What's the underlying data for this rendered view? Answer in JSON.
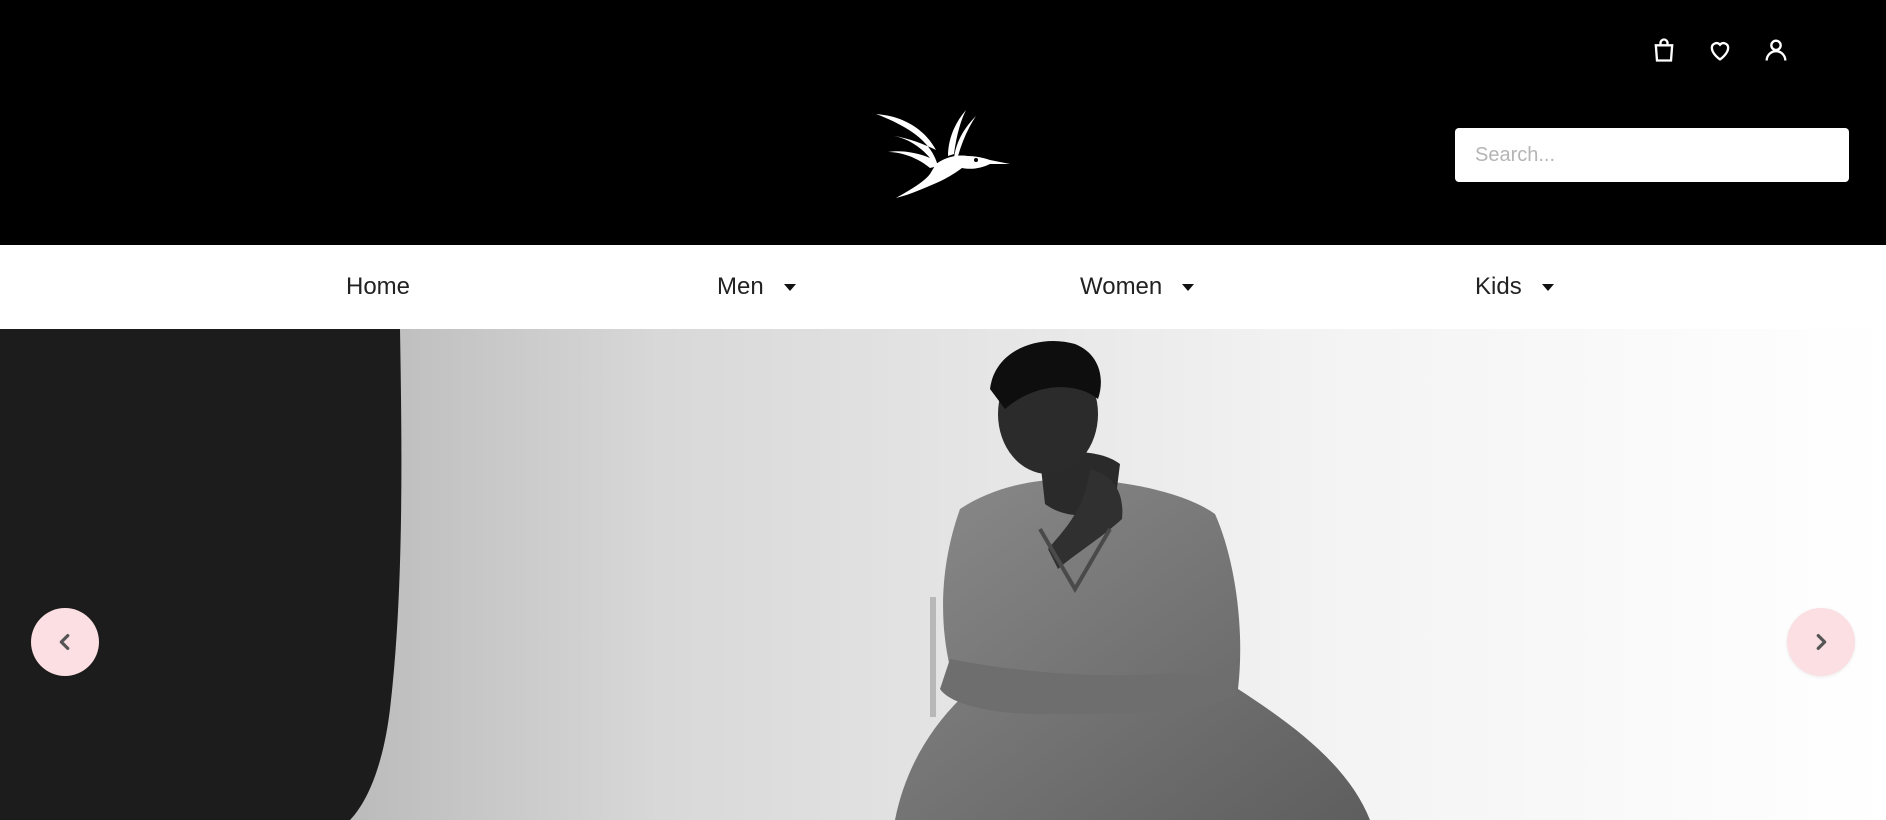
{
  "header": {
    "icons": [
      "shopping-bag-icon",
      "heart-icon",
      "user-icon"
    ],
    "logo": "hummingbird-logo",
    "search": {
      "placeholder": "Search...",
      "value": ""
    }
  },
  "nav": {
    "items": [
      {
        "label": "Home",
        "has_dropdown": false
      },
      {
        "label": "Men",
        "has_dropdown": true
      },
      {
        "label": "Women",
        "has_dropdown": true
      },
      {
        "label": "Kids",
        "has_dropdown": true
      }
    ]
  },
  "hero": {
    "image": "black-and-white photo of a woman in a pinstripe suit seated on a chair",
    "prev_icon": "chevron-left-icon",
    "next_icon": "chevron-right-icon"
  },
  "colors": {
    "header_bg": "#000000",
    "nav_bg": "#ffffff",
    "arrow_bg": "#fbdfe2",
    "arrow_icon": "#555555"
  }
}
